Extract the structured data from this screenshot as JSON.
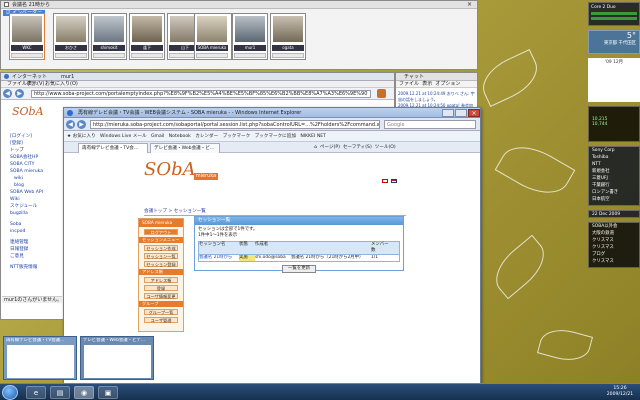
{
  "conference": {
    "window_title": "会議名 21時から",
    "checkbox_label": "インベーダー",
    "participants": [
      {
        "name": "WKC"
      },
      {
        "name": "おひさ"
      },
      {
        "name": "shimokit"
      },
      {
        "name": "逢下"
      },
      {
        "name": "山下"
      },
      {
        "name": "SOBA mieruka"
      },
      {
        "name": "mur1"
      },
      {
        "name": "ogata"
      }
    ]
  },
  "browser": {
    "title": "インターネット",
    "title_user": "mur1",
    "menu": [
      "ファイル(F)",
      "表示(V)",
      "お気に入り(O)"
    ],
    "address": "http://www.soba-project.com/portalemptyindex.php?%E8%9F%B2%E5%A4%BE%E5%BF%85%E6%B2%BB%E8%A7%A3%E6%9E%90",
    "sidebar_items": [
      "[ログイン]",
      "[登録]",
      "トップ",
      "SOBA会社HP",
      "SOBA CITY",
      "SOBA mieruka",
      "wiki",
      "blog",
      "SOBA Web API",
      "Wiki",
      "スケジュール",
      "bugzilla",
      "Soba",
      "incpod",
      "連絡管理",
      "日報登録",
      "ご意見",
      "NTT販売情報"
    ],
    "status_user": "mur1のさんがいません。"
  },
  "chat": {
    "title": "チャット",
    "menu": [
      "ファイル",
      "表示",
      "オプション"
    ],
    "messages": [
      "2009.12.21 at 10:24:49 おりべ さん: 宇宙の話をしましょう。",
      "2009.12.21 at 10:24:50 ogata! 参会加しました。"
    ]
  },
  "ie": {
    "title": "再有線デレビ会議・TV会議 - WEB会議システム - SOBA mieruka - - Windows Internet Explorer",
    "address": "http://mieruka.soba-project.com/sobaportal/portal.session.list.php?sobaControlURL=...%2Fholders%2Fcommand.xml",
    "search_placeholder": "Google",
    "favorites": [
      "お気に入り",
      "Windows Live メール",
      "Gmail",
      "Notebook",
      "カレンダー",
      "ブックマーク",
      "ブックマークに追加",
      "NIKKEI NET"
    ],
    "tabs": [
      "再有線デレビ会議・TV会...",
      "デレビ会議・Web会議・ビ..."
    ],
    "toolbar_right": [
      "ページ(P)",
      "セーフティ(S)",
      "ツール(O)"
    ],
    "site": {
      "logo": "SObA",
      "logo_suffix": "mieruka",
      "breadcrumb": "会議トップ > セッション一覧",
      "user_select": "soba",
      "sidebar_header": "SOBA mieruka",
      "logout": "ログアウト",
      "menu_sections": [
        {
          "label": "セッションメニュー",
          "items": [
            "セッション作成",
            "セッション一覧",
            "セッション登録"
          ]
        },
        {
          "label": "アドレス帳",
          "items": [
            "アドレス帳",
            "登録",
            "ユーザ情報変更"
          ]
        },
        {
          "label": "グループ",
          "items": [
            "グループ一覧",
            "ユーザ管理",
            "ユーザ管理"
          ]
        }
      ],
      "panel_title": "セッション一覧",
      "panel_note": "セッションは全部で1件です。",
      "panel_note2": "1件中1～1件を表示",
      "table_headers": [
        "セッション名",
        "状態",
        "作成者",
        "メンバー数"
      ],
      "table_row": {
        "name": "会議名 21時から",
        "state": "実施",
        "creator": "shi.odo@soba",
        "description": "会議名 21時から（21時から2月中）",
        "count": "1/1"
      },
      "panel_button": "一覧を更新"
    }
  },
  "previews": [
    {
      "title": "再有線デレビ会議・TV会議..."
    },
    {
      "title": "デレビ会議・Web会議・ビデ..."
    }
  ],
  "gadgets": {
    "cpu": "Core 2 Duo",
    "weather_temp": "5°",
    "weather_city": "東京都 千代田区",
    "calendar_month": "'09 12月",
    "stock_value": "10,215",
    "stock_value2": "10,744",
    "news_items": [
      "Sony Corp",
      "Toshiba",
      "NTT",
      "新規会社",
      "三菱UFJ",
      "千葉銀行",
      "ロシアン書き",
      "日本航空"
    ],
    "date": "22 Dec 2009",
    "feed_items": [
      "SOBA以外会",
      "大阪の鉄道",
      "クリスマス",
      "クリスマス",
      "ブログ",
      "クリスマス"
    ]
  },
  "taskbar": {
    "clock_time": "15:26",
    "clock_date": "2009/12/21"
  }
}
